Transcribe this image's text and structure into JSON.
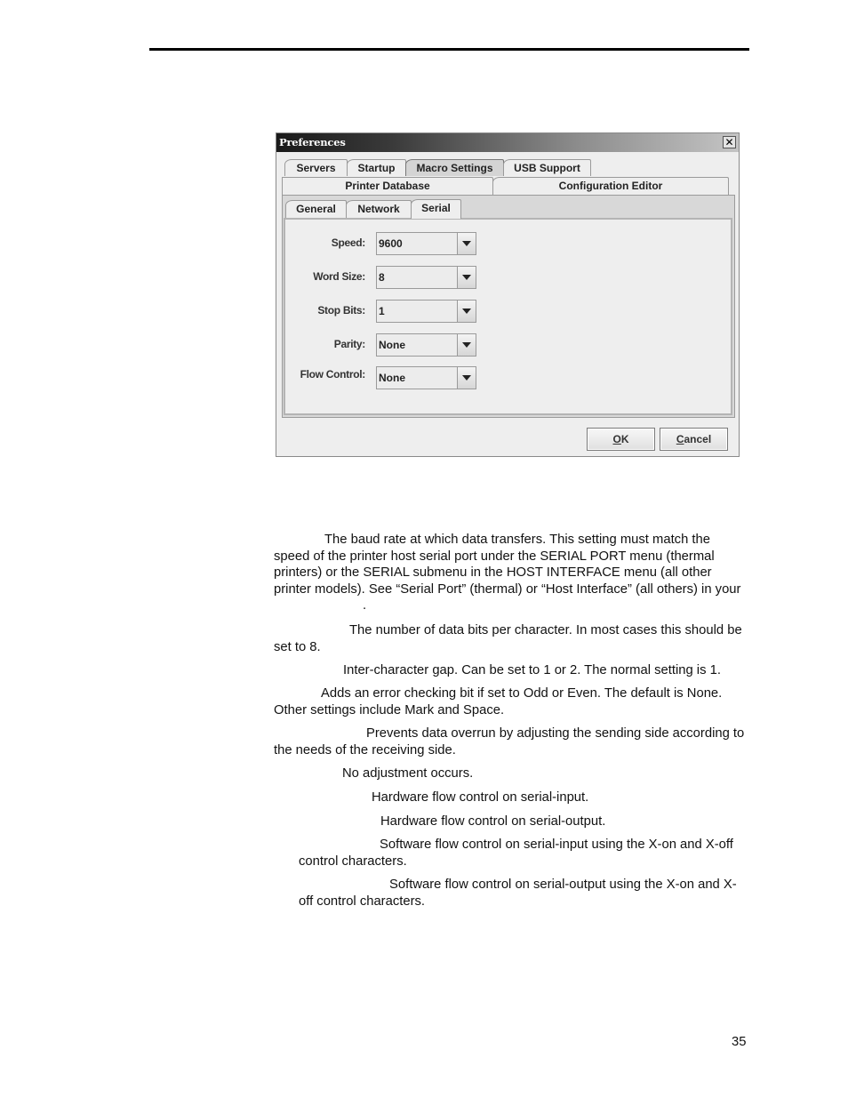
{
  "dialog": {
    "title": "Preferences",
    "close_icon": "close-icon",
    "top_tabs_row1": [
      {
        "label": "Servers"
      },
      {
        "label": "Startup"
      },
      {
        "label": "Macro Settings",
        "state": "pressed"
      },
      {
        "label": "USB Support"
      }
    ],
    "top_tabs_row2": [
      {
        "label": "Printer Database"
      },
      {
        "label": "Configuration Editor",
        "state": "selected"
      }
    ],
    "sub_tabs": [
      {
        "label": "General"
      },
      {
        "label": "Network"
      },
      {
        "label": "Serial",
        "state": "selected"
      }
    ],
    "fields": [
      {
        "label": "Speed:",
        "value": "9600"
      },
      {
        "label": "Word Size:",
        "value": "8"
      },
      {
        "label": "Stop Bits:",
        "value": "1"
      },
      {
        "label": "Parity:",
        "value": "None"
      },
      {
        "label": "Flow Control:",
        "value": "None"
      }
    ],
    "buttons": {
      "ok_mnemonic": "O",
      "ok_rest": "K",
      "cancel_mnemonic": "C",
      "cancel_rest": "ancel"
    }
  },
  "document": {
    "paragraphs": [
      {
        "text": "The baud rate at which data transfers. This setting must match the speed of the printer host serial port under the SERIAL PORT menu (thermal printers) or the SERIAL submenu in the HOST INTERFACE menu (all other printer models). See “Serial Port” (thermal) or “Host Interface” (all others) in your",
        "tail": "."
      },
      {
        "text": "The number of data bits per character. In most cases this should be set to 8."
      },
      {
        "text": "Inter-character gap. Can be set to 1 or 2. The normal setting is 1."
      },
      {
        "text": "Adds an error checking bit if set to Odd or Even. The default is None. Other settings include Mark and Space."
      },
      {
        "text": "Prevents data overrun by adjusting the sending side according to the needs of the receiving side."
      },
      {
        "text": "No adjustment occurs."
      },
      {
        "text": "Hardware flow control on serial-input."
      },
      {
        "text": "Hardware flow control on serial-output."
      },
      {
        "text": "Software flow control on serial-input using the X-on and X-off control characters."
      },
      {
        "text": "Software flow control on serial-output using the X-on and X-off control characters."
      }
    ],
    "page_number": "35"
  }
}
